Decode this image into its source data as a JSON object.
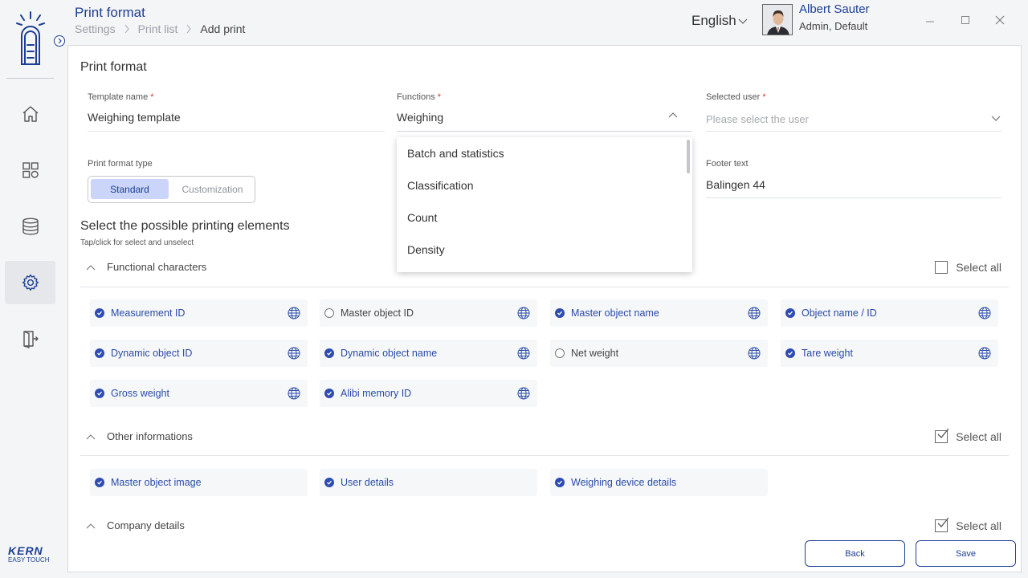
{
  "header": {
    "title": "Print format",
    "breadcrumbs": [
      "Settings",
      "Print list",
      "Add print"
    ],
    "language": "English",
    "user_name": "Albert Sauter",
    "user_role": "Admin, Default"
  },
  "sidebar": {
    "items": [
      {
        "name": "home",
        "icon": "home-icon"
      },
      {
        "name": "apps",
        "icon": "apps-grid-icon"
      },
      {
        "name": "database",
        "icon": "database-icon"
      },
      {
        "name": "settings",
        "icon": "gear-icon",
        "active": true
      },
      {
        "name": "logout",
        "icon": "logout-icon"
      }
    ],
    "brand": "KERN",
    "brand_sub": "EASY TOUCH"
  },
  "form": {
    "card_title": "Print format",
    "template_name_label": "Template name",
    "template_name_value": "Weighing template",
    "functions_label": "Functions",
    "functions_value": "Weighing",
    "selected_user_label": "Selected user",
    "selected_user_placeholder": "Please select the user",
    "required_mark": "*",
    "print_format_type_label": "Print format type",
    "type_options": [
      "Standard",
      "Customization"
    ],
    "type_selected": "Standard",
    "footer_text_label": "Footer text",
    "footer_text_value": "Balingen 44"
  },
  "dropdown": {
    "options": [
      "Batch and statistics",
      "Classification",
      "Count",
      "Density"
    ]
  },
  "elements": {
    "title": "Select the possible printing elements",
    "subtitle": "Tap/click for select and unselect",
    "select_all_label": "Select all",
    "groups": [
      {
        "name": "Functional characters",
        "select_all_checked": false,
        "items": [
          {
            "label": "Measurement ID",
            "selected": true
          },
          {
            "label": "Master object ID",
            "selected": false
          },
          {
            "label": "Master object name",
            "selected": true
          },
          {
            "label": "Object name / ID",
            "selected": true
          },
          {
            "label": "Dynamic object ID",
            "selected": true
          },
          {
            "label": "Dynamic object name",
            "selected": true
          },
          {
            "label": "Net weight",
            "selected": false
          },
          {
            "label": "Tare weight",
            "selected": true
          },
          {
            "label": "Gross weight",
            "selected": true
          },
          {
            "label": "Alibi memory ID",
            "selected": true
          }
        ]
      },
      {
        "name": "Other informations",
        "select_all_checked": true,
        "items": [
          {
            "label": "Master object image",
            "selected": true
          },
          {
            "label": "User details",
            "selected": true
          },
          {
            "label": "Weighing device details",
            "selected": true
          }
        ]
      },
      {
        "name": "Company details",
        "select_all_checked": true,
        "items": []
      }
    ]
  },
  "actions": {
    "back_label": "Back",
    "save_label": "Save"
  },
  "colors": {
    "accent": "#1c3f94",
    "selected_text": "#2a4ba8",
    "segment_active": "#cbd5fa"
  }
}
